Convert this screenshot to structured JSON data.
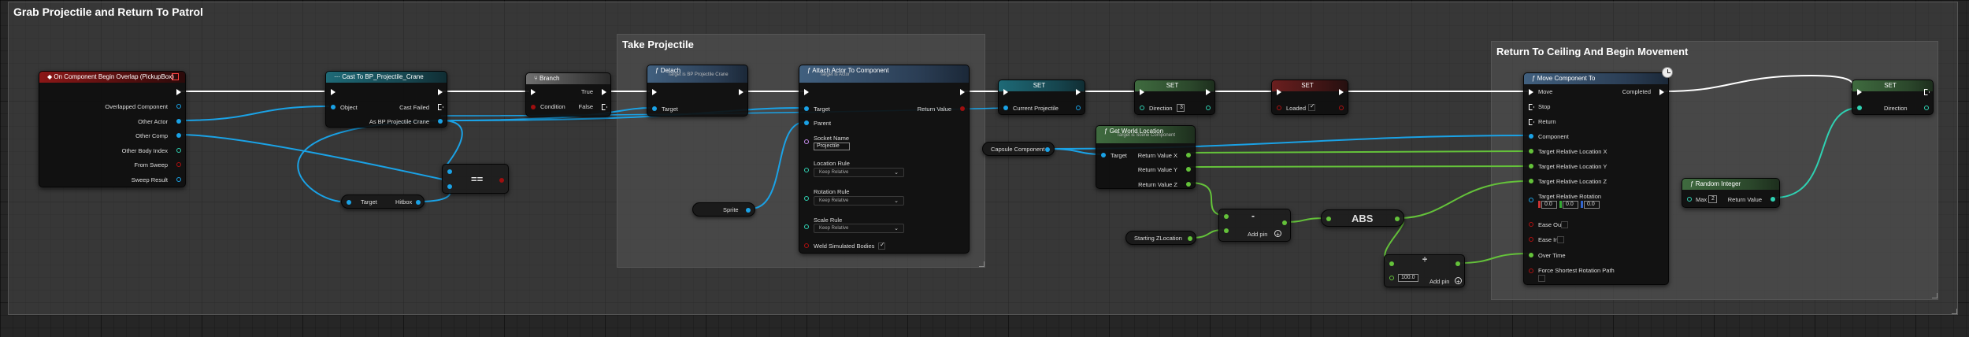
{
  "comments": {
    "main": "Grab Projectile and Return To Patrol",
    "take": "Take Projectile",
    "returnc": "Return To Ceiling And Begin Movement"
  },
  "node_overlap": {
    "title": "On Component Begin Overlap (PickupBox)",
    "pins": [
      "Overlapped Component",
      "Other Actor",
      "Other Comp",
      "Other Body Index",
      "From Sweep",
      "Sweep Result"
    ]
  },
  "node_cast": {
    "title": "Cast To BP_Projectile_Crane",
    "object": "Object",
    "cast_failed": "Cast Failed",
    "as_bp": "As BP Projectile Crane"
  },
  "node_branch": {
    "title": "Branch",
    "condition": "Condition",
    "true": "True",
    "false": "False"
  },
  "node_equals": {
    "label": "=="
  },
  "node_hitbox": {
    "target": "Target",
    "output": "Hitbox"
  },
  "node_detach": {
    "title": "Detach",
    "subtitle": "Target is BP Projectile Crane",
    "target": "Target"
  },
  "node_sprite": {
    "label": "Sprite"
  },
  "node_attach": {
    "title": "Attach Actor To Component",
    "subtitle": "Target is Actor",
    "target": "Target",
    "parent": "Parent",
    "return_value": "Return Value",
    "socket_name": "Socket Name",
    "socket_value": "Projectile",
    "location_rule": "Location Rule",
    "location_value": "Keep Relative",
    "rotation_rule": "Rotation Rule",
    "rotation_value": "Keep Relative",
    "scale_rule": "Scale Rule",
    "scale_value": "Keep Relative",
    "weld": "Weld Simulated Bodies"
  },
  "node_set1": {
    "title": "SET",
    "pin": "Current Projectile"
  },
  "node_set2": {
    "title": "SET",
    "pin": "Direction",
    "value": "3"
  },
  "node_set3": {
    "title": "SET",
    "pin": "Loaded"
  },
  "node_capsule": {
    "label": "Capsule Component"
  },
  "node_getloc": {
    "title": "Get World Location",
    "subtitle": "Target is Scene Component",
    "target": "Target",
    "rx": "Return Value X",
    "ry": "Return Value Y",
    "rz": "Return Value Z"
  },
  "node_startz": {
    "label": "Starting ZLocation"
  },
  "node_minus": {
    "op": "-",
    "add_pin": "Add pin"
  },
  "node_abs": {
    "label": "ABS"
  },
  "node_div": {
    "op": "÷",
    "value": "100.0",
    "add_pin": "Add pin"
  },
  "node_move": {
    "title": "Move Component To",
    "move": "Move",
    "completed": "Completed",
    "stop": "Stop",
    "return": "Return",
    "component": "Component",
    "tx": "Target Relative Location X",
    "ty": "Target Relative Location Y",
    "tz": "Target Relative Location Z",
    "trot": "Target Relative Rotation",
    "rot_values": [
      "0.0",
      "0.0",
      "0.0"
    ],
    "ease_out": "Ease Out",
    "ease_in": "Ease In",
    "over_time": "Over Time",
    "force": "Force Shortest Rotation Path"
  },
  "node_random": {
    "title": "Random Integer",
    "max": "Max",
    "max_value": "2",
    "return_value": "Return Value"
  },
  "node_set4": {
    "title": "SET",
    "pin": "Direction"
  },
  "colors": {
    "exec": "#ffffff",
    "object_pin": "#1aa2e6",
    "float_pin": "#64c23a",
    "int_pin": "#2fd1b2",
    "bool_pin": "#9e0f0f"
  }
}
